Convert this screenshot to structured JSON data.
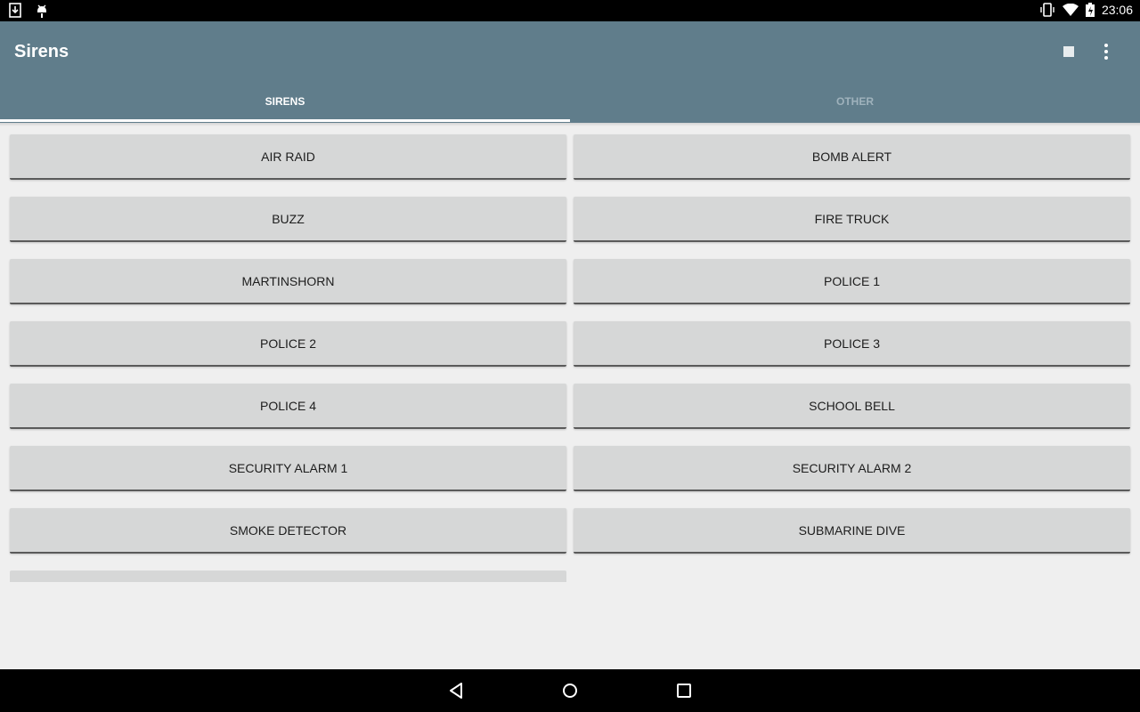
{
  "status_bar": {
    "left_icons": [
      "download-icon",
      "android-debug-icon"
    ],
    "right_icons": [
      "vibrate-icon",
      "wifi-icon",
      "battery-charging-icon"
    ],
    "time": "23:06"
  },
  "app_bar": {
    "title": "Sirens",
    "actions": [
      "stop-icon",
      "more-vert-icon"
    ],
    "color": "#607d8b"
  },
  "tabs": [
    {
      "label": "SIRENS",
      "active": true
    },
    {
      "label": "OTHER",
      "active": false
    }
  ],
  "buttons": [
    {
      "label": "AIR RAID"
    },
    {
      "label": "BOMB ALERT"
    },
    {
      "label": "BUZZ"
    },
    {
      "label": "FIRE TRUCK"
    },
    {
      "label": "MARTINSHORN"
    },
    {
      "label": "POLICE 1"
    },
    {
      "label": "POLICE 2"
    },
    {
      "label": "POLICE 3"
    },
    {
      "label": "POLICE 4"
    },
    {
      "label": "SCHOOL BELL"
    },
    {
      "label": "SECURITY ALARM 1"
    },
    {
      "label": "SECURITY ALARM 2"
    },
    {
      "label": "SMOKE DETECTOR"
    },
    {
      "label": "SUBMARINE DIVE"
    }
  ],
  "nav_bar": [
    "back-icon",
    "home-icon",
    "recents-icon"
  ]
}
